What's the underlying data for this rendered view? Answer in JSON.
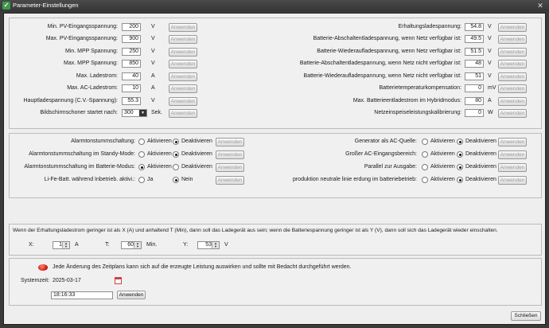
{
  "window": {
    "title": "Parameter-Einstellungen",
    "close": "✕"
  },
  "apply": "Anwenden",
  "left_params": [
    {
      "label": "Min. PV-Eingangsspannung:",
      "value": "200",
      "unit": "V"
    },
    {
      "label": "Max. PV-Eingangsspannung:",
      "value": "900",
      "unit": "V"
    },
    {
      "label": "Min. MPP Spannung:",
      "value": "250",
      "unit": "V"
    },
    {
      "label": "Max. MPP Spannung:",
      "value": "850",
      "unit": "V"
    },
    {
      "label": "Max. Ladestrom:",
      "value": "40",
      "unit": "A"
    },
    {
      "label": "Max. AC-Ladestrom:",
      "value": "10",
      "unit": "A"
    },
    {
      "label": "Hauptladespannung (C.V.-Spannung):",
      "value": "55.3",
      "unit": "V"
    }
  ],
  "screensaver": {
    "label": "Bildschirmschoner startet nach:",
    "value": "300",
    "unit": "Sek."
  },
  "right_params": [
    {
      "label": "Erhaltungsladespannung:",
      "value": "54.8",
      "unit": "V"
    },
    {
      "label": "Batterie-Abschaltentladespannung, wenn Netz verfügbar ist:",
      "value": "49.5",
      "unit": "V"
    },
    {
      "label": "Batterie-Wiederaufladespannung, wenn Netz verfügbar ist:",
      "value": "51.5",
      "unit": "V"
    },
    {
      "label": "Batterie-Abschaltentladespannung, wenn Netz nicht verfügbar ist:",
      "value": "48",
      "unit": "V"
    },
    {
      "label": "Batterie-Wiederaufladespannung, wenn Netz nicht verfügbar ist:",
      "value": "51",
      "unit": "V"
    },
    {
      "label": "Batterietemperaturkompensation:",
      "value": "0",
      "unit": "mV"
    },
    {
      "label": "Max. Batterieentladestrom im Hybridmodus:",
      "value": "80",
      "unit": "A"
    },
    {
      "label": "Netzeinspeiseleistungskalibrierung:",
      "value": "0",
      "unit": "W"
    }
  ],
  "left_options": [
    {
      "label": "Alarmtonstummschaltung:",
      "opt1": "Aktivieren",
      "opt2": "Deaktivieren",
      "selected": 2
    },
    {
      "label": "Alarmtonstummschaltung im Standy-Mode:",
      "opt1": "Aktivieren",
      "opt2": "Deaktivieren",
      "selected": 2
    },
    {
      "label": "Alarmtonstummschaltung im Batterie-Modus:",
      "opt1": "Aktivieren",
      "opt2": "Deaktivieren",
      "selected": 1
    },
    {
      "label": "Li-Fe-Batt. während Inbetrieb. aktivi.:",
      "opt1": "Ja",
      "opt2": "Nein",
      "selected": 2
    }
  ],
  "right_options": [
    {
      "label": "Generator als AC-Quelle:",
      "opt1": "Aktivieren",
      "opt2": "Deaktivieren",
      "selected": 2
    },
    {
      "label": "Großer AC-Eingangsbereich:",
      "opt1": "Aktivieren",
      "opt2": "Deaktivieren",
      "selected": 2
    },
    {
      "label": "Parallel zur Ausgabe:",
      "opt1": "Aktivieren",
      "opt2": "Deaktivieren",
      "selected": 2
    },
    {
      "label": "produktion neutrale linie erdung im batteriebetrieb:",
      "opt1": "Aktivieren",
      "opt2": "Deaktivieren",
      "selected": 2
    }
  ],
  "charge_stop": {
    "text": "Wenn der Erhaltungsladestrom geringer ist als X (A) und anhaltend T (Min), dann soll das Ladegerät aus sein; wenn die Batteriespannung geringer ist als Y (V), dann soll sich das Ladegerät wieder einschalten.",
    "x_label": "X:",
    "x_value": "1",
    "x_unit": "A",
    "t_label": "T:",
    "t_value": "60",
    "t_unit": "Min.",
    "y_label": "Y:",
    "y_value": "53",
    "y_unit": "V"
  },
  "schedule": {
    "warning": "Jede Änderung des Zeitplans kann sich auf die erzeugte Leistung auswirken und sollte mit Bedacht durchgeführt werden.",
    "system_time_label": "Systemzeit:",
    "date": "2025-03-17",
    "time": "18:16:33",
    "apply": "Anwenden"
  },
  "close_button": "Schließen"
}
